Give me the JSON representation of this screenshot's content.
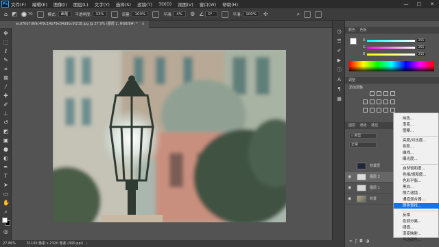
{
  "menubar": {
    "logo": "Ps",
    "items": [
      "文件(F)",
      "编辑(E)",
      "图像(I)",
      "图层(L)",
      "文字(Y)",
      "选择(S)",
      "滤镜(T)",
      "3D(D)",
      "视图(V)",
      "窗口(W)",
      "帮助(H)"
    ],
    "window_controls": [
      "—",
      "□",
      "✕"
    ]
  },
  "options": {
    "brush_size": "70",
    "mode_label": "模式:",
    "mode_value": "画笔",
    "opacity_label": "不透明度:",
    "opacity_value": "33%",
    "flow_label": "流量:",
    "flow_value": "100%",
    "smoothing_label": "平滑:",
    "smoothing_value": "4%",
    "angle_value": "0°",
    "extra_label": "平滑:",
    "extra_value": "100%"
  },
  "document": {
    "tab_label": "ecd76d7d69c4f9c14b79e34d9bc0f218.jpg @ 27.9% (图层 2, RGB/8#) *",
    "tab_close": "×"
  },
  "status": {
    "zoom": "27.86%",
    "info": "31100 像素 x 2320 像素 (300 ppi)"
  },
  "panels": {
    "color_tabs": [
      "颜色",
      "色板"
    ],
    "sliders": [
      {
        "label": "R",
        "value": "255"
      },
      {
        "label": "G",
        "value": "255"
      },
      {
        "label": "B",
        "value": "255"
      }
    ],
    "adjust_tab": "调整",
    "adjust_title": "添加调整",
    "layers_tabs": [
      "图层",
      "通道",
      "路径"
    ],
    "kind_filter": "类型",
    "blend_mode": "正常",
    "layers": [
      {
        "name": "背景层",
        "visible": false
      },
      {
        "name": "图层 2",
        "visible": true
      },
      {
        "name": "图层 1",
        "visible": true
      },
      {
        "name": "背景",
        "visible": true
      }
    ]
  },
  "adjustment_menu": {
    "groups": [
      [
        "纯色...",
        "渐变...",
        "图案..."
      ],
      [
        "亮度/对比度...",
        "色阶...",
        "曲线...",
        "曝光度..."
      ],
      [
        "自然饱和度...",
        "色相/饱和度...",
        "色彩平衡...",
        "黑白...",
        "照片滤镜...",
        "通道混合器...",
        "颜色查找..."
      ],
      [
        "反相",
        "色调分离...",
        "阈值...",
        "渐变映射...",
        "可选颜色..."
      ]
    ],
    "active_item": "颜色查找..."
  },
  "colors": {
    "accent": "#1473e6",
    "foreground_swatch": "#ffffff",
    "background_swatch": "#000000"
  }
}
